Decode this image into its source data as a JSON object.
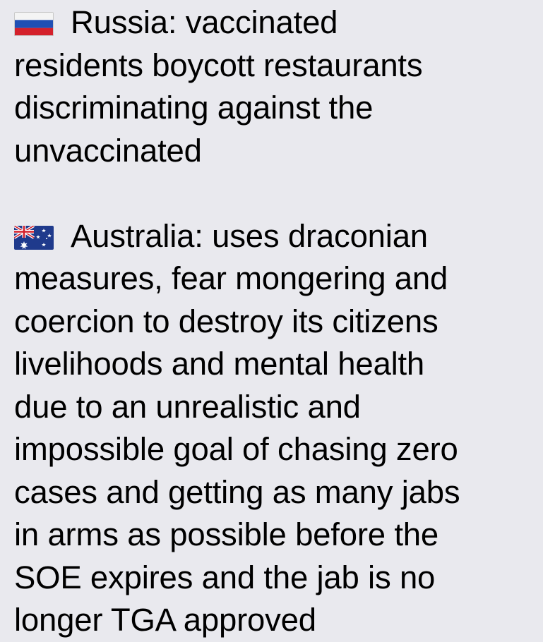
{
  "colors": {
    "background": "#e9e9ee",
    "text": "#000000"
  },
  "russia": {
    "flag_icon": "russia-flag-icon",
    "lines": [
      "Russia: vaccinated",
      "residents boycott restaurants",
      "discriminating against the",
      "unvaccinated"
    ]
  },
  "australia": {
    "flag_icon": "australia-flag-icon",
    "lines": [
      "Australia: uses draconian",
      "measures, fear mongering and",
      "coercion to destroy its citizens",
      "livelihoods and mental health",
      "due to an unrealistic and",
      "impossible goal of chasing zero",
      "cases and getting as many jabs",
      "in arms as possible before the",
      "SOE expires and the jab is no",
      "longer TGA approved"
    ]
  }
}
